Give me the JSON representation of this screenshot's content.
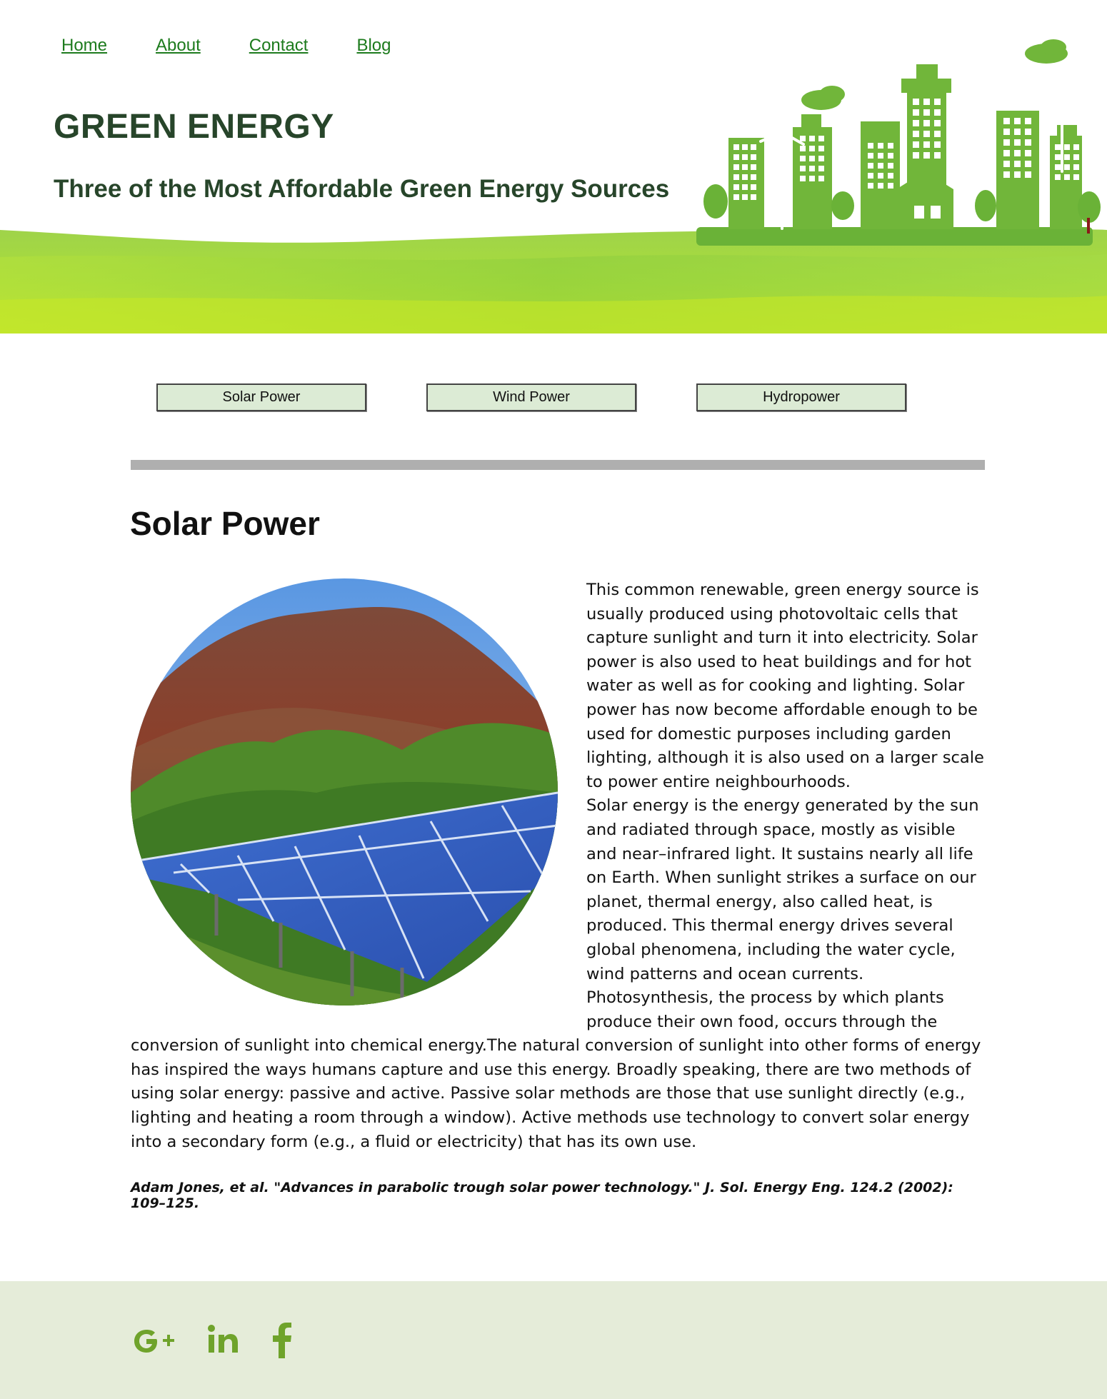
{
  "nav": {
    "items": [
      "Home",
      "About",
      "Contact",
      "Blog"
    ]
  },
  "header": {
    "title": "GREEN ENERGY",
    "subtitle": "Three of the Most Affordable Green Energy Sources"
  },
  "tabs": [
    "Solar Power",
    "Wind Power",
    "Hydropower"
  ],
  "section": {
    "title": "Solar Power",
    "paragraph_1": "This common renewable, green energy source is usually produced using photovoltaic cells that capture sunlight and turn it into electricity. Solar power is also used to heat buildings and for hot water as well as for cooking and lighting. Solar power has now become affordable enough to be used for domestic purposes including garden lighting, although it is also used on a larger scale to power entire neighbourhoods.",
    "paragraph_2": "Solar energy is the energy generated by the sun and radiated through space, mostly as visible and near–infrared light. It sustains nearly all life on Earth. When sunlight strikes a surface on our planet, thermal energy, also called heat, is produced. This thermal energy drives several global phenomena, including the water cycle, wind patterns and ocean currents. Photosynthesis, the process by which plants produce their own food, occurs through the conversion of sunlight into chemical energy.The natural conversion of sunlight into other forms of energy has inspired the ways humans capture and use this energy. Broadly speaking, there are two methods of using solar energy: passive and active. Passive solar methods are those that use sunlight directly (e.g., lighting and heating a room through a window). Active methods use technology to convert solar energy into a secondary form (e.g., a fluid or electricity) that has its own use.",
    "citation": "Adam Jones, et al. \"Advances in parabolic trough solar power technology.\" J. Sol. Energy Eng. 124.2 (2002): 109–125."
  },
  "footer": {
    "social_icons": [
      "google-plus-icon",
      "linkedin-icon",
      "facebook-icon"
    ]
  },
  "colors": {
    "nav_link": "#1d7b1d",
    "title_text": "#27452a",
    "tab_bg": "#dcebd5",
    "divider": "#afafaf",
    "footer_bg": "#e5ecd9",
    "icon_green": "#6fa32b"
  }
}
